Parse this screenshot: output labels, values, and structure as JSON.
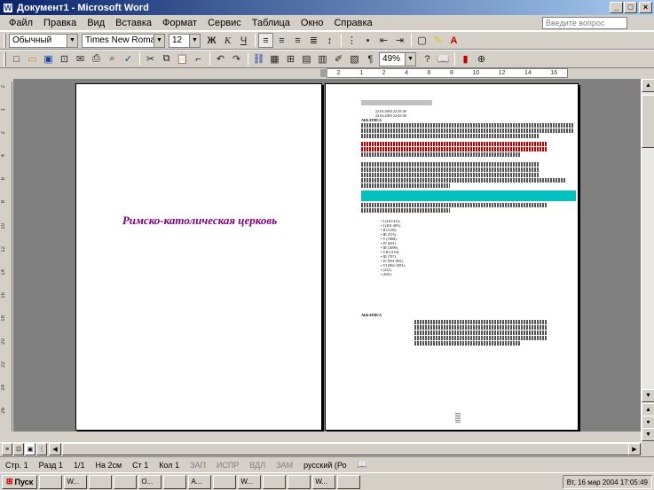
{
  "window": {
    "title": "Документ1 - Microsoft Word"
  },
  "menu": [
    "Файл",
    "Правка",
    "Вид",
    "Вставка",
    "Формат",
    "Сервис",
    "Таблица",
    "Окно",
    "Справка"
  ],
  "help_placeholder": "Введите вопрос",
  "format_toolbar": {
    "style": "Обычный",
    "font": "Times New Roman",
    "size": "12"
  },
  "standard_toolbar": {
    "zoom": "49%"
  },
  "ruler": {
    "marks": [
      "2",
      "1",
      "2",
      "4",
      "6",
      "8",
      "10",
      "12",
      "14",
      "16"
    ]
  },
  "vruler": {
    "marks": [
      "2",
      "1",
      "2",
      "4",
      "6",
      "8",
      "10",
      "12",
      "14",
      "16",
      "18",
      "20",
      "22",
      "24",
      "26"
    ]
  },
  "page1": {
    "title": "Римско-католическая церковь"
  },
  "page2": {
    "header_label": "АББАТИСА",
    "timestamp": "22.03.2003 22:45:58",
    "heading": "АББАТИСА",
    "heading2": "АББАТИСА",
    "list_items": [
      "I (410-411).",
      "I (401-403).",
      "II (1105).",
      "III (313).",
      "V (1068).",
      "IV (601).",
      "III (1099).",
      "VII (1119).",
      "III (797).",
      "IV (991-903).",
      "VI (992-1053).",
      "(412).",
      "(635)."
    ]
  },
  "status": {
    "page": "Стр. 1",
    "section": "Разд 1",
    "pages": "1/1",
    "at": "На 2см",
    "line": "Ст 1",
    "col": "Кол 1",
    "rec": "ЗАП",
    "trk": "ИСПР",
    "ext": "ВДЛ",
    "ovr": "ЗАМ",
    "lang": "русский (Ро"
  },
  "taskbar": {
    "start": "Пуск",
    "tasks": [
      "",
      "W...",
      "",
      "",
      "O...",
      "",
      "A...",
      "",
      "W...",
      "",
      "",
      "W...",
      ""
    ],
    "clock": "Вт, 16 мар 2004   17:05:49"
  }
}
